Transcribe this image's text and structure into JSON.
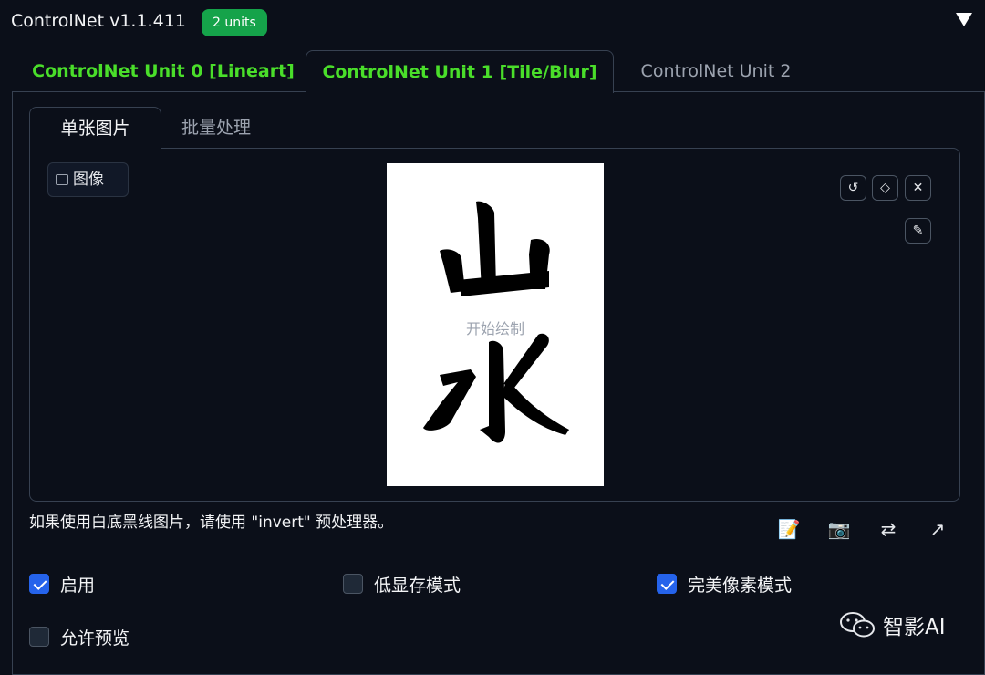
{
  "header": {
    "title": "ControlNet v1.1.411",
    "badge": "2 units"
  },
  "unit_tabs": [
    {
      "label": "ControlNet Unit 0 [Lineart]"
    },
    {
      "label": "ControlNet Unit 1 [Tile/Blur]",
      "selected": true
    },
    {
      "label": "ControlNet Unit 2"
    }
  ],
  "sub_tabs": [
    {
      "label": "单张图片",
      "selected": true
    },
    {
      "label": "批量处理"
    }
  ],
  "image_panel": {
    "label": "图像",
    "canvas_hint": "开始绘制",
    "canvas_chars": [
      "山",
      "水"
    ]
  },
  "hint": "如果使用白底黑线图片，请使用 \"invert\" 预处理器。",
  "options": {
    "enable": {
      "label": "启用",
      "checked": true
    },
    "low_vram": {
      "label": "低显存模式",
      "checked": false
    },
    "pixel_perfect": {
      "label": "完美像素模式",
      "checked": true
    },
    "allow_preview": {
      "label": "允许预览",
      "checked": false
    }
  },
  "watermark": "智影AI",
  "colors": {
    "background": "#0b0f19",
    "active_tab": "#4ade2a",
    "badge": "#15a34a",
    "checkbox_on": "#2563eb"
  }
}
